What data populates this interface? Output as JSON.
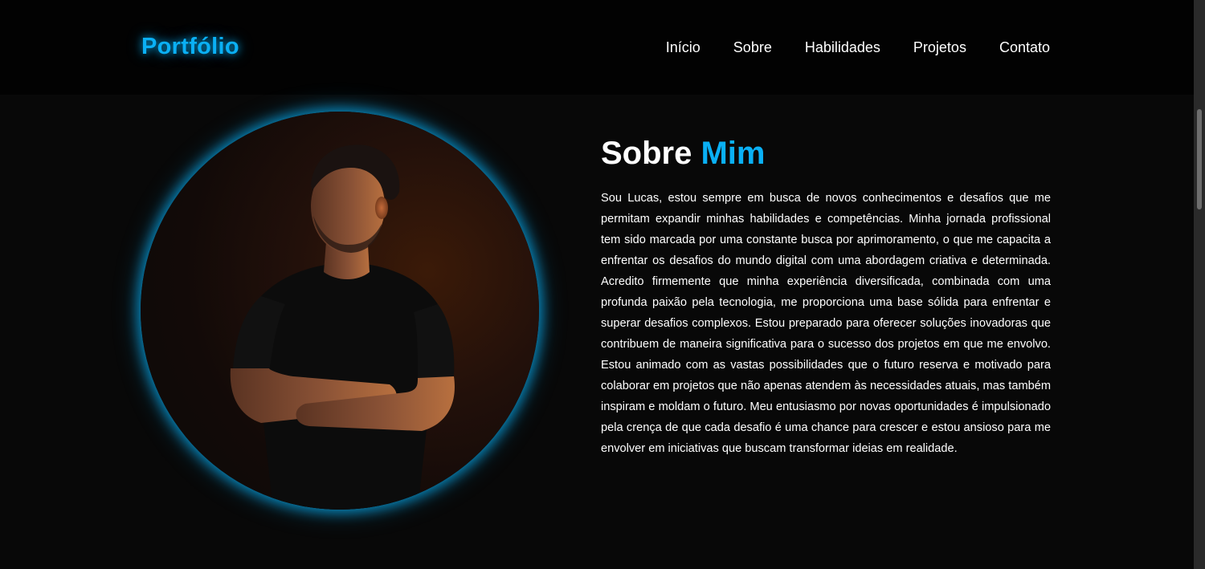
{
  "header": {
    "logo": "Portfólio",
    "nav": [
      "Início",
      "Sobre",
      "Habilidades",
      "Projetos",
      "Contato"
    ]
  },
  "about": {
    "title_part1": "Sobre",
    "title_part2": "Mim",
    "body": "Sou Lucas, estou sempre em busca de novos conhecimentos e desafios que me permitam expandir minhas habilidades e competências. Minha jornada profissional tem sido marcada por uma constante busca por aprimoramento, o que me capacita a enfrentar os desafios do mundo digital com uma abordagem criativa e determinada. Acredito firmemente que minha experiência diversificada, combinada com uma profunda paixão pela tecnologia, me proporciona uma base sólida para enfrentar e superar desafios complexos. Estou preparado para oferecer soluções inovadoras que contribuem de maneira significativa para o sucesso dos projetos em que me envolvo. Estou animado com as vastas possibilidades que o futuro reserva e motivado para colaborar em projetos que não apenas atendem às necessidades atuais, mas também inspiram e moldam o futuro. Meu entusiasmo por novas oportunidades é impulsionado pela crença de que cada desafio é uma chance para crescer e estou ansioso para me envolver em iniciativas que buscam transformar ideias em realidade."
  },
  "colors": {
    "accent": "#0ab0f5",
    "background": "#080808",
    "header_background": "#020202"
  }
}
